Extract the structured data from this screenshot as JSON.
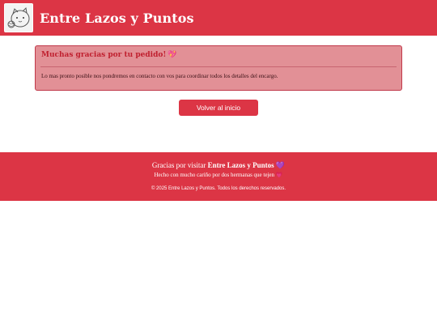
{
  "header": {
    "brand": "Entre Lazos y Puntos"
  },
  "alert": {
    "title": "Muchas gracias por tu pedido!",
    "title_icon": "💖",
    "body": "Lo mas pronto posible nos pondremos en contacto con vos para coordinar todos los detalles del encargo."
  },
  "actions": {
    "back_label": "Volver al inicio"
  },
  "footer": {
    "thanks_prefix": "Gracias por visitar",
    "thanks_brand": "Entre Lazos y Puntos",
    "thanks_icon": "💜",
    "made_with": "Hecho con mucho cariño por dos hermanas que tejen",
    "made_icon": "💗",
    "copyright": "© 2025 Entre Lazos y Puntos. Todos los derechos reservados."
  },
  "colors": {
    "brand_red": "#dc3545",
    "alert_bg": "#e29096",
    "alert_border": "#c0394a",
    "alert_title": "#c0202f"
  }
}
